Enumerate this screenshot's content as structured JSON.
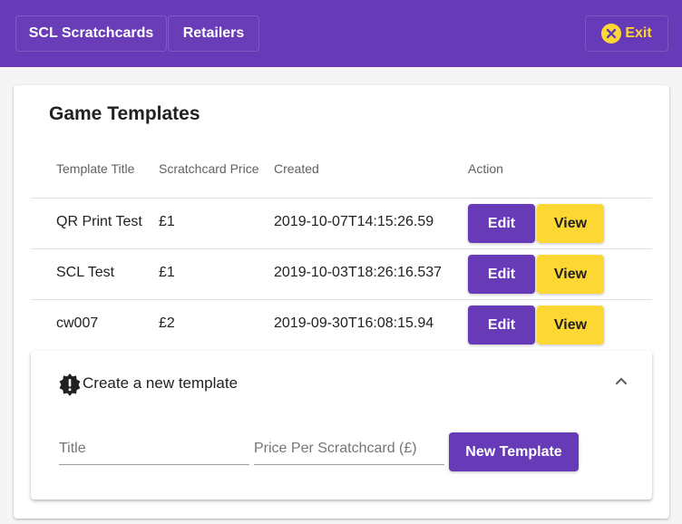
{
  "nav": {
    "scl_label": "SCL Scratchcards",
    "retailers_label": "Retailers",
    "exit_label": "Exit",
    "exit_icon": "close-circle-icon"
  },
  "colors": {
    "primary": "#673ab7",
    "accent": "#fdd835"
  },
  "card": {
    "title": "Game Templates"
  },
  "table": {
    "headers": [
      "Template Title",
      "Scratchcard Price",
      "Created",
      "Action"
    ],
    "rows": [
      {
        "title": "QR Print Test",
        "price": "£1",
        "created": "2019-10-07T14:15:26.59",
        "edit": "Edit",
        "view": "View"
      },
      {
        "title": "SCL Test",
        "price": "£1",
        "created": "2019-10-03T18:26:16.537",
        "edit": "Edit",
        "view": "View"
      },
      {
        "title": "cw007",
        "price": "£2",
        "created": "2019-09-30T16:08:15.94",
        "edit": "Edit",
        "view": "View"
      }
    ]
  },
  "create_panel": {
    "title": "Create a new template",
    "icon": "alert-badge-icon",
    "title_placeholder": "Title",
    "price_placeholder": "Price Per Scratchcard (£)",
    "title_value": "",
    "price_value": "",
    "submit_label": "New Template",
    "expanded": true
  }
}
